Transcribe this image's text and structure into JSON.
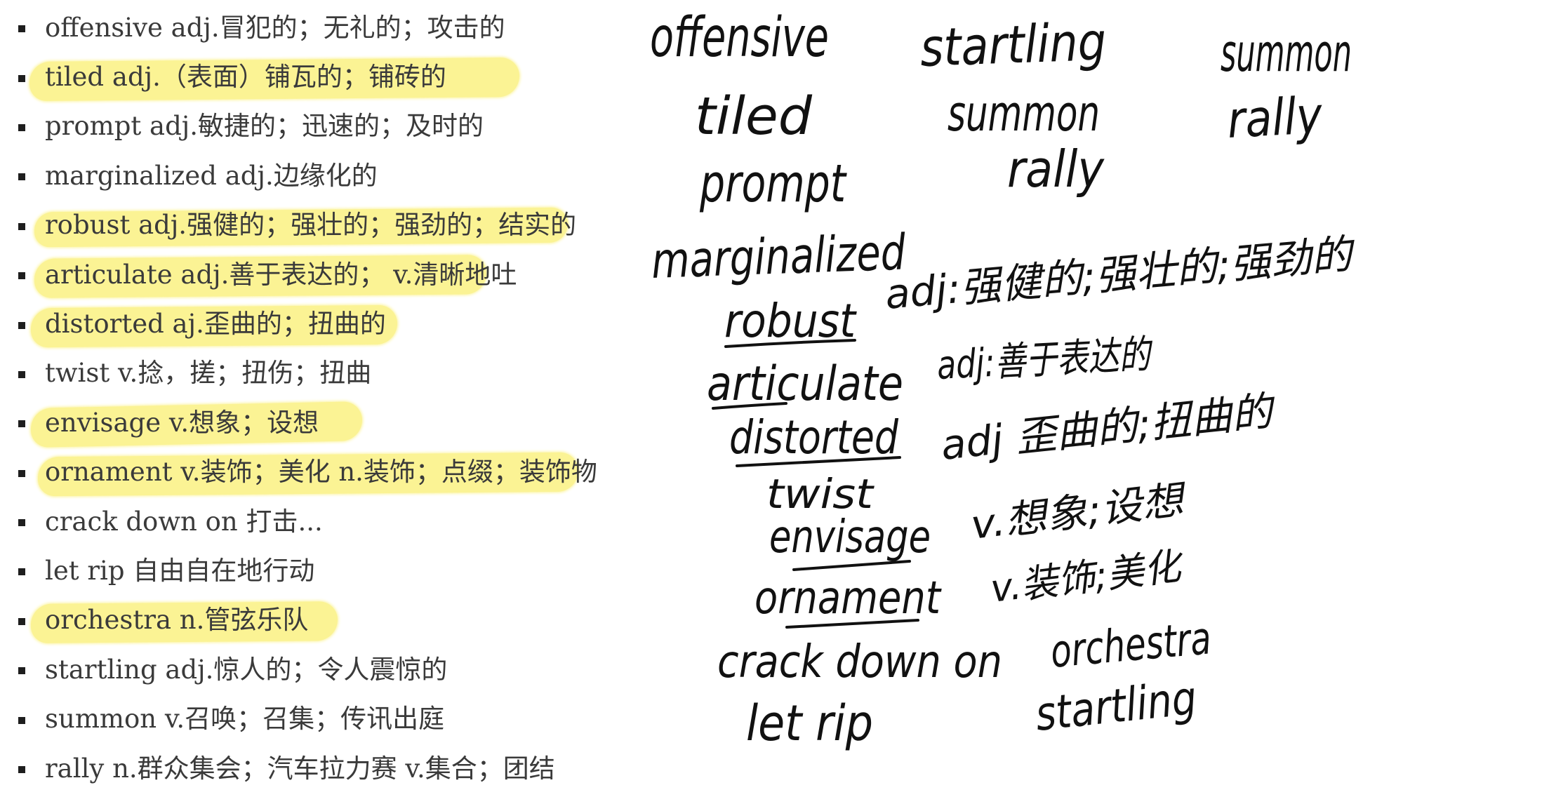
{
  "colors": {
    "highlight": "#fbf28c",
    "text": "#3a3a3a",
    "ink": "#111111",
    "bullet": "#1e1e1e"
  },
  "vocab_list": {
    "items": [
      {
        "text": "offensive adj.冒犯的；无礼的；攻击的",
        "highlighted": false
      },
      {
        "text": "tiled adj.（表面）铺瓦的；铺砖的",
        "highlighted": true
      },
      {
        "text": "prompt adj.敏捷的；迅速的；及时的",
        "highlighted": false
      },
      {
        "text": "marginalized adj.边缘化的",
        "highlighted": false
      },
      {
        "text": "robust adj.强健的；强壮的；强劲的；结实的",
        "highlighted": true
      },
      {
        "text": "articulate adj.善于表达的； v.清晰地吐",
        "highlighted": true
      },
      {
        "text": "distorted aj.歪曲的；扭曲的",
        "highlighted": true
      },
      {
        "text": "twist v.捻，搓；扭伤；扭曲",
        "highlighted": false
      },
      {
        "text": "envisage v.想象；设想",
        "highlighted": true
      },
      {
        "text": "ornament v.装饰；美化 n.装饰；点缀；装饰物",
        "highlighted": true
      },
      {
        "text": "crack down on 打击...",
        "highlighted": false
      },
      {
        "text": "let rip 自由自在地行动",
        "highlighted": false
      },
      {
        "text": "orchestra n.管弦乐队",
        "highlighted": true
      },
      {
        "text": "startling adj.惊人的；令人震惊的",
        "highlighted": false
      },
      {
        "text": "summon v.召唤；召集；传讯出庭",
        "highlighted": false
      },
      {
        "text": "rally n.群众集会；汽车拉力赛 v.集合；团结",
        "highlighted": false
      }
    ]
  },
  "handwritten_notes": {
    "items": [
      "offensive",
      "startling",
      "summon",
      "tiled",
      "summon",
      "rally",
      "prompt",
      "rally",
      "marginalized",
      "robust",
      "adj:强健的;强壮的;强劲的",
      "articulate",
      "adj:善于表达的",
      "distorted",
      "adj 歪曲的;扭曲的",
      "twist",
      "envisage",
      "v.想象;设想",
      "ornament",
      "v.装饰;美化",
      "crack down on",
      "orchestra",
      "let rip",
      "startling"
    ]
  }
}
